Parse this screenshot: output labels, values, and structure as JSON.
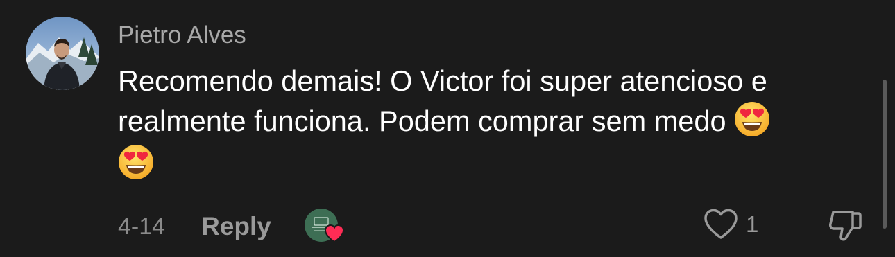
{
  "comment": {
    "author": "Pietro Alves",
    "text_line1": "Recomendo demais! O Victor foi super atencioso e",
    "text_line2": "realmente funciona. Podem comprar sem medo",
    "emoji": "smiling-face-with-heart-eyes",
    "date": "4-14",
    "reply_label": "Reply",
    "creator_liked": true,
    "like_count": "1",
    "icons": {
      "like": "heart-outline-icon",
      "dislike": "thumbs-down-icon",
      "creator_badge": "heart-icon"
    }
  },
  "colors": {
    "background": "#1b1b1b",
    "username": "#a8a8a8",
    "text": "#ffffff",
    "secondary": "#9a9a9a",
    "creator_heart": "#fe2c55"
  }
}
